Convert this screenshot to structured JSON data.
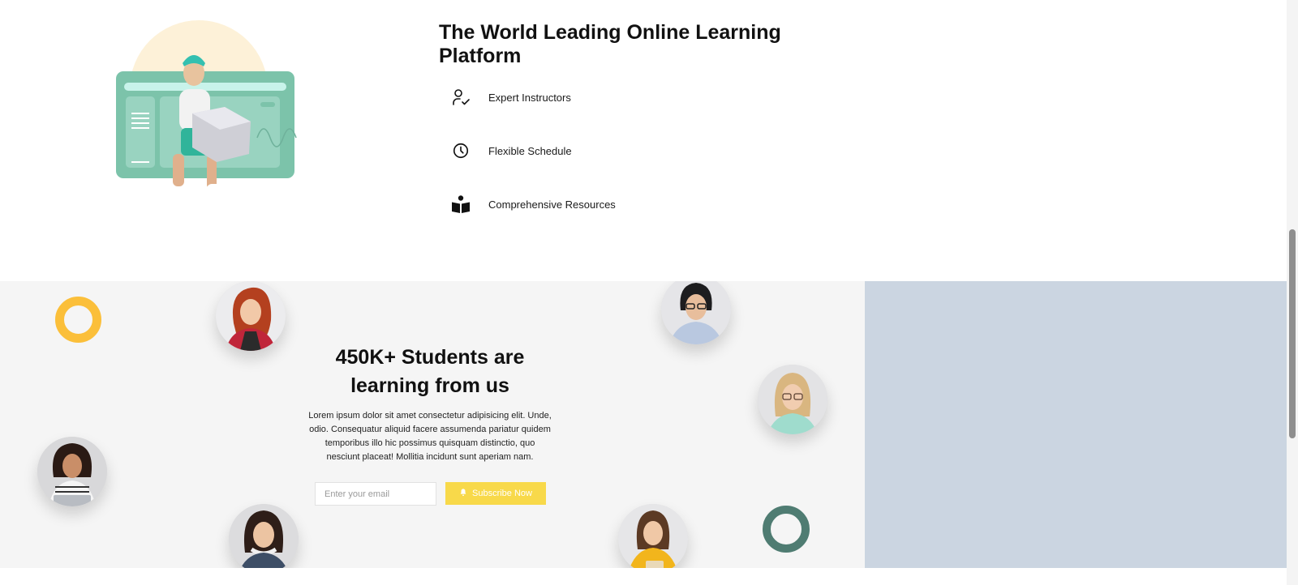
{
  "hero": {
    "title": "The World Leading Online Learning Platform",
    "features": [
      {
        "label": "Expert Instructors",
        "icon": "user-check-icon"
      },
      {
        "label": "Flexible Schedule",
        "icon": "clock-icon"
      },
      {
        "label": "Comprehensive Resources",
        "icon": "book-reader-icon"
      }
    ]
  },
  "promo": {
    "title": "450K+ Students are learning from us",
    "description": "Lorem ipsum dolor sit amet consectetur adipisicing elit. Unde, odio. Consequatur aliquid facere assumenda pariatur quidem temporibus illo hic possimus quisquam distinctio, quo nesciunt placeat! Mollitia incidunt sunt aperiam nam.",
    "email_placeholder": "Enter your email",
    "email_value": "",
    "subscribe_label": "Subscribe Now"
  },
  "colors": {
    "accent_yellow": "#f8d94a",
    "ring_yellow": "#fbbf3a",
    "ring_green": "#4f7c72",
    "promo_bg": "#f5f5f5",
    "side_panel_bg": "#cbd5e1"
  }
}
